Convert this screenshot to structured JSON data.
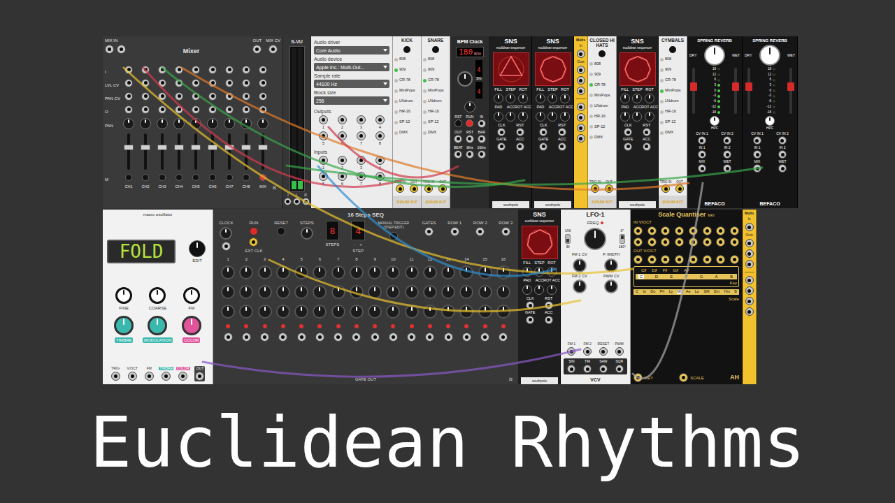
{
  "title": "Euclidean Rhythms",
  "top_row": [
    {
      "kind": "mixer",
      "title": "Mixer",
      "mix_in": "MIX IN",
      "row_labels": [
        "I",
        "LVL CV",
        "PAN CV",
        "O"
      ],
      "pan_label": "PAN",
      "mute_label": "M",
      "out_label": "OUT",
      "mix_cv_label": "MIX CV",
      "logo": "ls",
      "channels": [
        {
          "name": "CH1",
          "level": 0.64,
          "muted": false
        },
        {
          "name": "CH2",
          "level": 0.64,
          "muted": false
        },
        {
          "name": "CH3",
          "level": 0.64,
          "muted": false
        },
        {
          "name": "CH4",
          "level": 0.64,
          "muted": false
        },
        {
          "name": "CH5",
          "level": 0.64,
          "muted": false
        },
        {
          "name": "CH6",
          "level": 0.64,
          "muted": false
        },
        {
          "name": "CH7",
          "level": 0.64,
          "muted": false
        },
        {
          "name": "CH8",
          "level": 0.64,
          "muted": false
        },
        {
          "name": "MIX",
          "level": 0.64,
          "muted": true
        }
      ]
    },
    {
      "kind": "vu",
      "title": "S-VU",
      "levels": [
        0.06,
        0.06
      ],
      "jack_labels": [
        "I",
        "L",
        "R"
      ]
    },
    {
      "kind": "audio",
      "fields": [
        {
          "label": "Audio driver",
          "value": "Core Audio"
        },
        {
          "label": "Audio device",
          "value": "Apple Inc.: Multi-Out..."
        },
        {
          "label": "Sample rate",
          "value": "44100 Hz"
        },
        {
          "label": "Block size",
          "value": "256"
        }
      ],
      "outputs_label": "Outputs",
      "outputs": [
        "1",
        "2",
        "3",
        "4",
        "5",
        "6",
        "7",
        "8"
      ],
      "inputs_label": "Inputs",
      "inputs": [
        "1",
        "2",
        "3",
        "4",
        "5",
        "6",
        "7",
        "8"
      ]
    },
    {
      "kind": "drum",
      "title": "KICK",
      "models": [
        {
          "label": "808",
          "selected": false
        },
        {
          "label": "909",
          "selected": true
        },
        {
          "label": "CR-78",
          "selected": false
        },
        {
          "label": "MiniPops",
          "selected": false
        },
        {
          "label": "LNdrum",
          "selected": false
        },
        {
          "label": "HR-16",
          "selected": false
        },
        {
          "label": "SP-12",
          "selected": false
        },
        {
          "label": "DMX",
          "selected": false
        }
      ],
      "trig_label": "TRIG IN",
      "out_label": "OUT",
      "logo": "DRUM KIT"
    },
    {
      "kind": "drum",
      "title": "SNARE",
      "models": [
        {
          "label": "808",
          "selected": false
        },
        {
          "label": "909",
          "selected": false
        },
        {
          "label": "CR-78",
          "selected": true
        },
        {
          "label": "MiniPops",
          "selected": false
        },
        {
          "label": "LNdrum",
          "selected": false
        },
        {
          "label": "HR-16",
          "selected": false
        },
        {
          "label": "SP-12",
          "selected": false
        },
        {
          "label": "DMX",
          "selected": false
        }
      ],
      "trig_label": "TRIG IN",
      "out_label": "OUT",
      "logo": "DRUM KIT"
    },
    {
      "kind": "clock",
      "title": "BPM Clock",
      "bpm": "180",
      "bpm_label": "BPM",
      "sig_top": "4",
      "sig_label": "SIG",
      "sig_bottom": "4",
      "controls": [
        {
          "label": "RST",
          "kind": "button",
          "lit": false
        },
        {
          "label": "RUN",
          "kind": "button",
          "lit": true
        },
        {
          "label": "IN",
          "kind": "jack",
          "lit": false
        },
        {
          "label": "OUT",
          "kind": "jack",
          "lit": false
        },
        {
          "label": "RST",
          "kind": "jack",
          "lit": false
        },
        {
          "label": "BAR",
          "kind": "jack",
          "lit": false
        },
        {
          "label": "BEAT",
          "kind": "jack",
          "lit": false
        },
        {
          "label": "8ths",
          "kind": "jack",
          "lit": false
        },
        {
          "label": "16ths",
          "kind": "jack",
          "lit": false
        }
      ]
    },
    {
      "kind": "sns",
      "title": "SNS",
      "subtitle": "euclidean sequencer",
      "vertices": 3,
      "knob_labels": [
        "FILL",
        "STEP",
        "ROT"
      ],
      "acc_labels": [
        "PAD",
        "ACC",
        "ROT ACC"
      ],
      "io_labels": [
        "CLK",
        "RST",
        "GATE",
        "ACC"
      ],
      "logo": "southpole"
    },
    {
      "kind": "sns",
      "title": "SNS",
      "subtitle": "euclidean sequencer",
      "vertices": 8,
      "knob_labels": [
        "FILL",
        "STEP",
        "ROT"
      ],
      "acc_labels": [
        "PAD",
        "ACC",
        "ROT ACC"
      ],
      "io_labels": [
        "CLK",
        "RST",
        "GATE",
        "ACC"
      ],
      "logo": "southpole"
    },
    {
      "kind": "mults",
      "title": "Mults",
      "in_label": "In",
      "outs_label": "Outs"
    },
    {
      "kind": "drum",
      "title": "CLOSED HI HATS",
      "models": [
        {
          "label": "808",
          "selected": false
        },
        {
          "label": "909",
          "selected": false
        },
        {
          "label": "CR-78",
          "selected": true
        },
        {
          "label": "MiniPops",
          "selected": false
        },
        {
          "label": "LNdrum",
          "selected": false
        },
        {
          "label": "HR-16",
          "selected": false
        },
        {
          "label": "SP-12",
          "selected": false
        },
        {
          "label": "DMX",
          "selected": false
        }
      ],
      "trig_label": "TRIG IN",
      "out_label": "OUT",
      "logo": "DRUM KIT"
    },
    {
      "kind": "sns",
      "title": "SNS",
      "subtitle": "euclidean sequencer",
      "vertices": 8,
      "knob_labels": [
        "FILL",
        "STEP",
        "ROT"
      ],
      "acc_labels": [
        "PAD",
        "ACC",
        "ROT ACC"
      ],
      "io_labels": [
        "CLK",
        "RST",
        "GATE",
        "ACC"
      ],
      "logo": "southpole"
    },
    {
      "kind": "drum",
      "title": "CYMBALS",
      "models": [
        {
          "label": "808",
          "selected": false
        },
        {
          "label": "909",
          "selected": false
        },
        {
          "label": "CR-78",
          "selected": false
        },
        {
          "label": "MiniPops",
          "selected": true
        },
        {
          "label": "LNdrum",
          "selected": false
        },
        {
          "label": "HR-16",
          "selected": false
        },
        {
          "label": "SP-12",
          "selected": false
        },
        {
          "label": "DMX",
          "selected": false
        }
      ],
      "trig_label": "TRIG IN",
      "out_label": "OUT",
      "logo": "DRUM KIT"
    },
    {
      "kind": "reverb",
      "title": "SPRING REVERB",
      "dry_label": "DRY",
      "wet_label": "WET",
      "cv_levels": [
        0.62,
        0.62
      ],
      "scale": [
        {
          "label": "18",
          "lit": false
        },
        {
          "label": "12",
          "lit": false
        },
        {
          "label": "6",
          "lit": false
        },
        {
          "label": "3",
          "lit": true
        },
        {
          "label": "0",
          "lit": true
        },
        {
          "label": "-3",
          "lit": true
        },
        {
          "label": "-6",
          "lit": true
        },
        {
          "label": "-12",
          "lit": true
        },
        {
          "label": "-18",
          "lit": true
        }
      ],
      "hpf_label": "HPF",
      "jack_labels": [
        "CV IN 1",
        "CV IN 2",
        "IN 1",
        "IN 2",
        "MIX",
        "WET"
      ],
      "logo": "BEFACO"
    },
    {
      "kind": "reverb",
      "title": "SPRING REVERB",
      "dry_label": "DRY",
      "wet_label": "WET",
      "cv_levels": [
        0.62,
        0.62
      ],
      "scale": [
        {
          "label": "18",
          "lit": false
        },
        {
          "label": "12",
          "lit": false
        },
        {
          "label": "6",
          "lit": false
        },
        {
          "label": "3",
          "lit": false
        },
        {
          "label": "0",
          "lit": false
        },
        {
          "label": "-3",
          "lit": false
        },
        {
          "label": "-6",
          "lit": false
        },
        {
          "label": "-12",
          "lit": false
        },
        {
          "label": "-18",
          "lit": false
        }
      ],
      "hpf_label": "HPF",
      "jack_labels": [
        "CV IN 1",
        "CV IN 2",
        "IN 1",
        "IN 2",
        "MIX",
        "WET"
      ],
      "logo": "BEFACO"
    }
  ],
  "bottom_row": [
    {
      "kind": "macro",
      "title": "macro oscillator",
      "display": "FOLD",
      "edit_label": "EDIT",
      "knobs": [
        {
          "label": "FINE",
          "color": "#ffffff"
        },
        {
          "label": "COARSE",
          "color": "#ffffff"
        },
        {
          "label": "FM",
          "color": "#ffffff"
        },
        {
          "label": "TIMBRE",
          "color": "#3bb8ae"
        },
        {
          "label": "MODULATION",
          "color": "#3bb8ae"
        },
        {
          "label": "COLOR",
          "color": "#e0549a"
        }
      ],
      "jacks": [
        {
          "label": "TRIG",
          "color": "#ffffff",
          "kind": "input"
        },
        {
          "label": "V/OCT",
          "color": "#ffffff",
          "kind": "input"
        },
        {
          "label": "FM",
          "color": "#ffffff",
          "kind": "input"
        },
        {
          "label": "TIMBRE",
          "color": "#3bb8ae",
          "kind": "input"
        },
        {
          "label": "COLOR",
          "color": "#e0549a",
          "kind": "input"
        },
        {
          "label": "OUT",
          "color": "#ffffff",
          "kind": "output"
        }
      ]
    },
    {
      "kind": "seq",
      "title": "16 Steps SEQ",
      "clock_label": "CLOCK",
      "run_label": "RUN",
      "reset_label": "RESET",
      "ext_clk_label": "EXT CLK",
      "steps_label": "STEPS",
      "steps_value": "8",
      "steps_caption": "STEPS",
      "step_value": "4",
      "step_caption": "STEP",
      "step_minus": "-",
      "step_plus": "+",
      "manual_label": "MANUAL TRIGGER (STEP EDIT)",
      "gates_label": "GATES",
      "row_labels": [
        "ROW 1",
        "ROW 2",
        "ROW 3"
      ],
      "columns": [
        {
          "label": "1",
          "gate": true
        },
        {
          "label": "2",
          "gate": true
        },
        {
          "label": "3",
          "gate": true
        },
        {
          "label": "4",
          "gate": true
        },
        {
          "label": "5",
          "gate": true
        },
        {
          "label": "6",
          "gate": true
        },
        {
          "label": "7",
          "gate": true
        },
        {
          "label": "8",
          "gate": true
        },
        {
          "label": "9",
          "gate": true
        },
        {
          "label": "10",
          "gate": true
        },
        {
          "label": "11",
          "gate": true
        },
        {
          "label": "12",
          "gate": true
        },
        {
          "label": "13",
          "gate": true
        },
        {
          "label": "14",
          "gate": true
        },
        {
          "label": "15",
          "gate": true
        },
        {
          "label": "16",
          "gate": true
        }
      ],
      "gate_out_label": "GATE OUT",
      "logo": "ls"
    },
    {
      "kind": "sns",
      "title": "SNS",
      "subtitle": "euclidean sequencer",
      "vertices": 7,
      "knob_labels": [
        "FILL",
        "STEP",
        "ROT"
      ],
      "acc_labels": [
        "PAD",
        "ACC",
        "ROT ACC"
      ],
      "io_labels": [
        "CLK",
        "RST",
        "GATE",
        "ACC"
      ],
      "logo": "southpole"
    },
    {
      "kind": "lfo",
      "title": "LFO-1",
      "freq_label": "FREQ",
      "switch1": [
        "UNI",
        "BI"
      ],
      "switch1_down": true,
      "switch2": [
        "0°",
        "180°"
      ],
      "switch2_down": false,
      "knob_labels": [
        "FM 1 CV",
        "P. WIDTH",
        "FM 2 CV",
        "PWM CV"
      ],
      "in_labels": [
        "FM 1",
        "FM 2",
        "RESET",
        "PWM"
      ],
      "out_labels": [
        "SIN",
        "TRI",
        "SAW",
        "SQR"
      ],
      "logo": "VCV"
    },
    {
      "kind": "quant",
      "title": "Scale Quantiser",
      "version": "MkII",
      "in_label": "IN V/OCT",
      "out_label": "OUT V/OCT",
      "sharps": [
        "C♯",
        "D♯",
        "F♯",
        "G♯",
        "A♯"
      ],
      "naturals": [
        {
          "label": "C",
          "selected": true
        },
        {
          "label": "D",
          "selected": false
        },
        {
          "label": "E",
          "selected": false
        },
        {
          "label": "F",
          "selected": false
        },
        {
          "label": "G",
          "selected": false
        },
        {
          "label": "A",
          "selected": false
        },
        {
          "label": "B",
          "selected": false
        }
      ],
      "key_caption": "Key",
      "scales": [
        {
          "label": "C",
          "selected": false
        },
        {
          "label": "Io",
          "selected": false
        },
        {
          "label": "Do",
          "selected": false
        },
        {
          "label": "Ph",
          "selected": false
        },
        {
          "label": "Ly",
          "selected": false
        },
        {
          "label": "Mi",
          "selected": true
        },
        {
          "label": "Ae",
          "selected": false
        },
        {
          "label": "Lo",
          "selected": false
        },
        {
          "label": "SM",
          "selected": false
        },
        {
          "label": "Sm",
          "selected": false
        },
        {
          "label": "Hm",
          "selected": false
        },
        {
          "label": "B",
          "selected": false
        }
      ],
      "scale_caption": "Scale",
      "key_label": "KEY",
      "scale_label": "SCALE",
      "logo": "AH"
    },
    {
      "kind": "mults",
      "title": "Mults",
      "in_label": "In",
      "outs_label": "Outs"
    }
  ],
  "cables": [
    {
      "color": "#e8c22e"
    },
    {
      "color": "#d23a4e"
    },
    {
      "color": "#3aa64b"
    },
    {
      "color": "#e07a2a"
    },
    {
      "color": "#3aa64b"
    },
    {
      "color": "#2f8fd0"
    },
    {
      "color": "#8a5ac8"
    },
    {
      "color": "#a8a8a8"
    },
    {
      "color": "#e8c22e"
    },
    {
      "color": "#d23a4e"
    }
  ]
}
